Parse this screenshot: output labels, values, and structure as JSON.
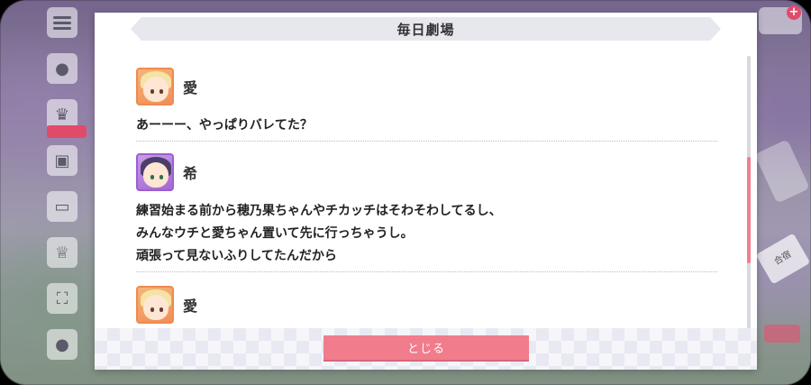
{
  "dialog": {
    "title": "毎日劇場",
    "close_label": "とじる"
  },
  "entries": [
    {
      "speaker": "愛",
      "avatar": "ai-avatar",
      "lines": [
        "あーーー、やっぱりバレてた？"
      ]
    },
    {
      "speaker": "希",
      "avatar": "nozomi-avatar",
      "lines": [
        "練習始まる前から穂乃果ちゃんやチカッチはそわそわしてるし、",
        "みんなウチと愛ちゃん置いて先に行っちゃうし。",
        "頑張って見ないふりしてたんだから"
      ]
    },
    {
      "speaker": "愛",
      "avatar": "ai-avatar",
      "lines": []
    }
  ],
  "background": {
    "side_menu_icons": [
      "hamburger-icon",
      "chat-icon",
      "event-icon",
      "gift-icon",
      "tv-icon",
      "crown-icon",
      "expand-icon",
      "profile-icon"
    ],
    "right_tag": "合宿"
  },
  "colors": {
    "accent": "#f17c8c",
    "scroll_thumb": "#f07f90",
    "ai_frame": "#f08a50",
    "nozomi_frame": "#9b5fd0"
  }
}
